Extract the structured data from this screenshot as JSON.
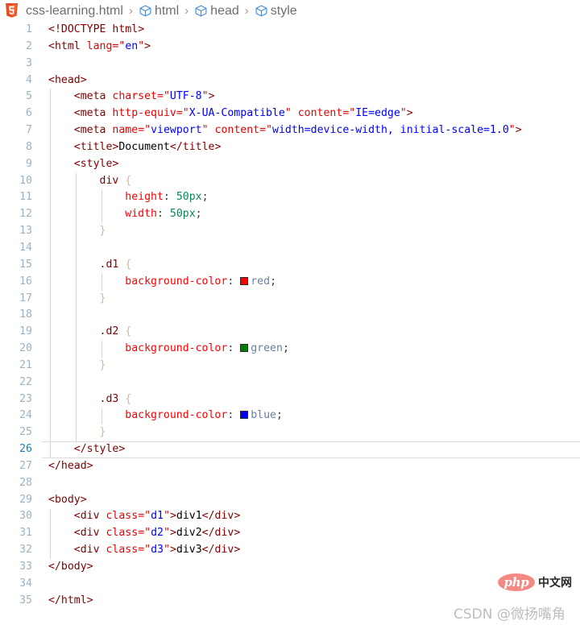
{
  "breadcrumb": {
    "file_icon": "html5-icon",
    "segments": [
      {
        "label": "css-learning.html",
        "icon": null
      },
      {
        "label": "html",
        "icon": "cube-icon"
      },
      {
        "label": "head",
        "icon": "cube-icon"
      },
      {
        "label": "style",
        "icon": "cube-icon"
      }
    ],
    "separator": "›"
  },
  "editor": {
    "active_line": 26,
    "first_line": 1,
    "last_line": 35,
    "colors": {
      "tag": "#800000",
      "attribute": "#e50000",
      "string": "#0000ff",
      "property": "#ff0000",
      "value": "#098658",
      "keyword": "#6a7fa0",
      "brace": "#cfc08a",
      "line_number": "#9bb3c4",
      "active_line_number": "#1a7fb5"
    },
    "swatches": {
      "red": "#ff0000",
      "green": "#008000",
      "blue": "#0000ff"
    },
    "lines": [
      {
        "n": 1,
        "text": "<!DOCTYPE html>"
      },
      {
        "n": 2,
        "text": "<html lang=\"en\">"
      },
      {
        "n": 3,
        "text": ""
      },
      {
        "n": 4,
        "text": "<head>"
      },
      {
        "n": 5,
        "text": "    <meta charset=\"UTF-8\">"
      },
      {
        "n": 6,
        "text": "    <meta http-equiv=\"X-UA-Compatible\" content=\"IE=edge\">"
      },
      {
        "n": 7,
        "text": "    <meta name=\"viewport\" content=\"width=device-width, initial-scale=1.0\">"
      },
      {
        "n": 8,
        "text": "    <title>Document</title>"
      },
      {
        "n": 9,
        "text": "    <style>"
      },
      {
        "n": 10,
        "text": "        div {"
      },
      {
        "n": 11,
        "text": "            height: 50px;"
      },
      {
        "n": 12,
        "text": "            width: 50px;"
      },
      {
        "n": 13,
        "text": "        }"
      },
      {
        "n": 14,
        "text": ""
      },
      {
        "n": 15,
        "text": "        .d1 {"
      },
      {
        "n": 16,
        "text": "            background-color: red;"
      },
      {
        "n": 17,
        "text": "        }"
      },
      {
        "n": 18,
        "text": ""
      },
      {
        "n": 19,
        "text": "        .d2 {"
      },
      {
        "n": 20,
        "text": "            background-color: green;"
      },
      {
        "n": 21,
        "text": "        }"
      },
      {
        "n": 22,
        "text": ""
      },
      {
        "n": 23,
        "text": "        .d3 {"
      },
      {
        "n": 24,
        "text": "            background-color: blue;"
      },
      {
        "n": 25,
        "text": "        }"
      },
      {
        "n": 26,
        "text": "    </style>"
      },
      {
        "n": 27,
        "text": "</head>"
      },
      {
        "n": 28,
        "text": ""
      },
      {
        "n": 29,
        "text": "<body>"
      },
      {
        "n": 30,
        "text": "    <div class=\"d1\">div1</div>"
      },
      {
        "n": 31,
        "text": "    <div class=\"d2\">div2</div>"
      },
      {
        "n": 32,
        "text": "    <div class=\"d3\">div3</div>"
      },
      {
        "n": 33,
        "text": "</body>"
      },
      {
        "n": 34,
        "text": ""
      },
      {
        "n": 35,
        "text": "</html>"
      }
    ]
  },
  "watermarks": {
    "php_logo_text": "php",
    "php_logo_cn": "中文网",
    "csdn": "CSDN @微扬嘴角"
  }
}
